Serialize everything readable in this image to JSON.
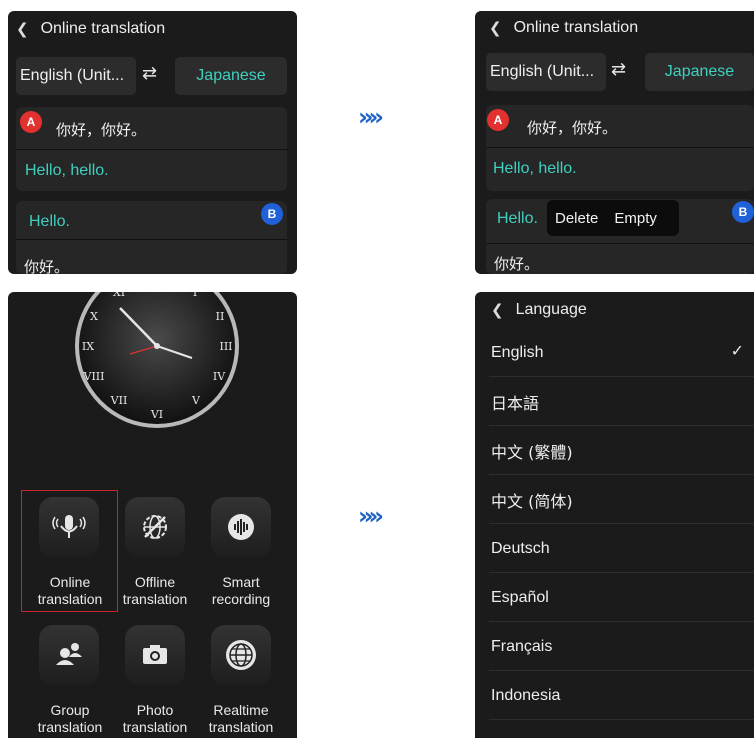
{
  "top_left": {
    "header_back_icon": "chevron-left-icon",
    "title": "Online translation",
    "source_lang": "English (Unit...",
    "swap_icon": "swap-arrows-icon",
    "target_lang": "Japanese",
    "msg_a_badge": "A",
    "msg_a_original": "你好，你好。",
    "msg_a_translation": "Hello, hello.",
    "msg_b_badge": "B",
    "msg_b_original": "Hello.",
    "msg_b_translation": "你好。"
  },
  "top_right": {
    "title": "Online translation",
    "source_lang": "English (Unit...",
    "target_lang": "Japanese",
    "msg_a_badge": "A",
    "msg_a_original": "你好，你好。",
    "msg_a_translation": "Hello, hello.",
    "msg_b_badge": "B",
    "msg_b_original": "Hello.",
    "msg_b_translation": "你好。",
    "context_menu": {
      "delete": "Delete",
      "empty": "Empty"
    }
  },
  "arrows": {
    "top": "»»",
    "bottom": "»»"
  },
  "home": {
    "clock_icon": "analog-clock-icon",
    "apps": [
      {
        "line1": "Online",
        "line2": "translation",
        "icon": "microphone-icon",
        "selected": true
      },
      {
        "line1": "Offline",
        "line2": "translation",
        "icon": "globe-off-icon"
      },
      {
        "line1": "Smart",
        "line2": "recording",
        "icon": "waveform-icon"
      },
      {
        "line1": "Group",
        "line2": "translation",
        "icon": "group-icon"
      },
      {
        "line1": "Photo",
        "line2": "translation",
        "icon": "camera-icon"
      },
      {
        "line1": "Realtime",
        "line2": "translation",
        "icon": "globe-icon"
      }
    ]
  },
  "language": {
    "title": "Language",
    "items": [
      "English",
      "日本語",
      "中文 (繁體)",
      "中文 (简体)",
      "Deutsch",
      "Español",
      "Français",
      "Indonesia"
    ],
    "selected": "English",
    "check_icon": "checkmark-icon"
  },
  "colors": {
    "panel_bg": "#1b1b1b",
    "accent_teal": "#3fd0c0",
    "badge_a": "#e2312f",
    "badge_b": "#2060d8",
    "arrow_blue": "#1e63c4",
    "selection_red": "#c8262a"
  }
}
